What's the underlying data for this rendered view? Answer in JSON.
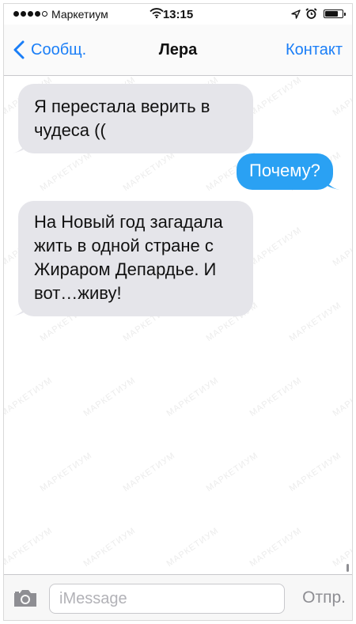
{
  "status_bar": {
    "carrier": "Маркетиум",
    "time": "13:15",
    "battery_level": 0.7
  },
  "nav": {
    "back_label": "Сообщ.",
    "title": "Лера",
    "contact_label": "Контакт"
  },
  "messages": [
    {
      "direction": "received",
      "text": "Я перестала верить в\nчудеса (("
    },
    {
      "direction": "sent",
      "text": "Почему?"
    },
    {
      "direction": "received",
      "text": "На Новый год загадала\nжить в одной стране с\nЖираром Депардье. И\nвот…живу!"
    }
  ],
  "input": {
    "placeholder": "iMessage",
    "send_label": "Отпр."
  },
  "watermark": "МАРКЕТИУМ",
  "colors": {
    "accent": "#1a7ef7",
    "sent_bubble": "#2aa1f3",
    "received_bubble": "#e5e5ea"
  }
}
